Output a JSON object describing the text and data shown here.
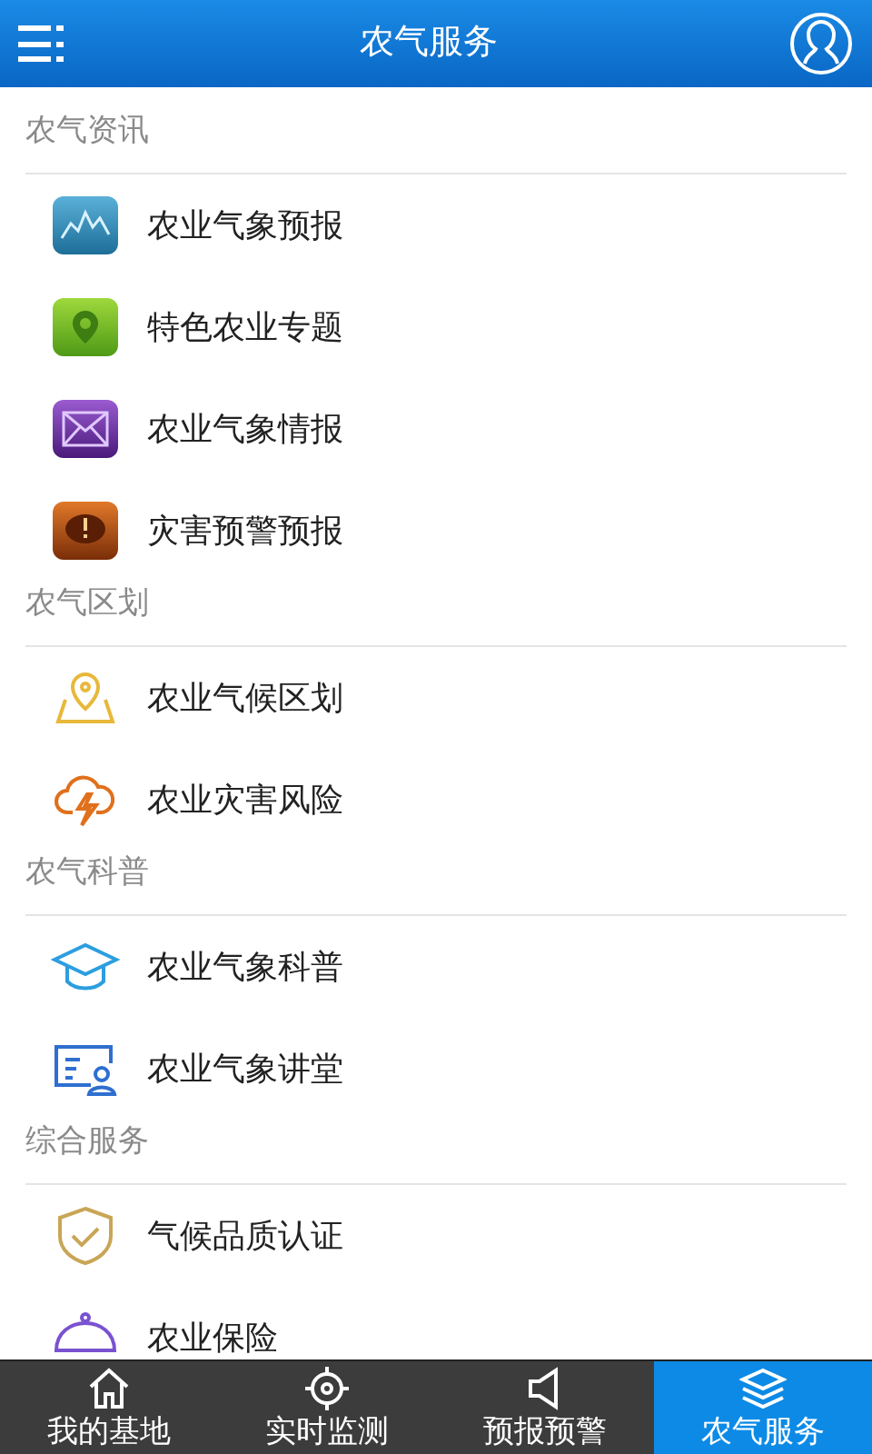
{
  "header": {
    "title": "农气服务"
  },
  "sections": [
    {
      "title": "农气资讯",
      "items": [
        {
          "label": "农业气象预报",
          "kind": "chart"
        },
        {
          "label": "特色农业专题",
          "kind": "pin"
        },
        {
          "label": "农业气象情报",
          "kind": "mail"
        },
        {
          "label": "灾害预警预报",
          "kind": "alert"
        }
      ]
    },
    {
      "title": "农气区划",
      "items": [
        {
          "label": "农业气候区划",
          "kind": "map"
        },
        {
          "label": "农业灾害风险",
          "kind": "storm"
        }
      ]
    },
    {
      "title": "农气科普",
      "items": [
        {
          "label": "农业气象科普",
          "kind": "cap"
        },
        {
          "label": "农业气象讲堂",
          "kind": "lecture"
        }
      ]
    },
    {
      "title": "综合服务",
      "items": [
        {
          "label": "气候品质认证",
          "kind": "shield"
        },
        {
          "label": "农业保险",
          "kind": "bell"
        }
      ]
    }
  ],
  "tabs": [
    {
      "label": "我的基地",
      "kind": "home",
      "selected": false
    },
    {
      "label": "实时监测",
      "kind": "target",
      "selected": false
    },
    {
      "label": "预报预警",
      "kind": "speaker",
      "selected": false
    },
    {
      "label": "农气服务",
      "kind": "layers",
      "selected": true
    }
  ]
}
